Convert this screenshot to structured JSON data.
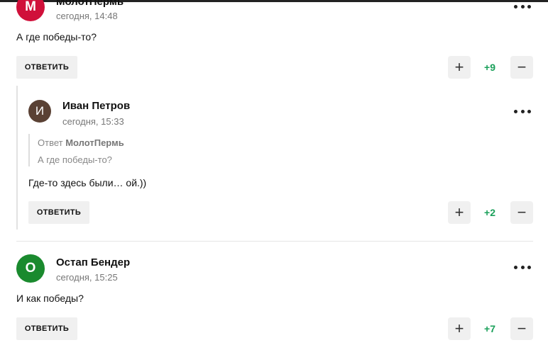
{
  "comments": [
    {
      "author": "МолотПермь",
      "avatar_letter": "М",
      "avatar_color": "#d0103a",
      "time": "сегодня, 14:48",
      "text": "А где победы-то?",
      "reply_label": "ОТВЕТИТЬ",
      "score": "+9"
    },
    {
      "author": "Иван Петров",
      "avatar_letter": "И",
      "avatar_color": "#5a4134",
      "time": "сегодня, 15:33",
      "quote_prefix": "Ответ",
      "quote_author": "МолотПермь",
      "quote_text": "А где победы-то?",
      "text": "Где-то здесь были… ой.))",
      "reply_label": "ОТВЕТИТЬ",
      "score": "+2"
    },
    {
      "author": "Остап Бендер",
      "avatar_letter": "О",
      "avatar_color": "#1a8a2e",
      "time": "сегодня, 15:25",
      "text": "И как победы?",
      "reply_label": "ОТВЕТИТЬ",
      "score": "+7"
    }
  ],
  "icons": {
    "more": "more-dots-icon",
    "upvote": "plus-icon",
    "downvote": "minus-icon"
  },
  "colors": {
    "score_positive": "#1aa05a",
    "button_bg": "#f0f0f0"
  }
}
